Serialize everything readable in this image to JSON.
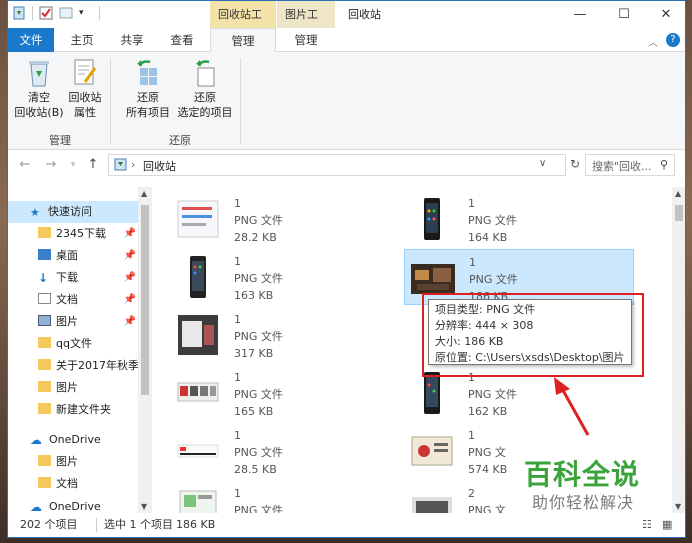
{
  "title": {
    "context_recycle": "回收站工具",
    "context_picture": "图片工具",
    "window_title": "回收站"
  },
  "tabs": [
    "文件",
    "主页",
    "共享",
    "查看",
    "管理",
    "管理"
  ],
  "ribbon": {
    "empty_line1": "清空",
    "empty_line2": "回收站(B)",
    "props_line1": "回收站",
    "props_line2": "属性",
    "restore_all_line1": "还原",
    "restore_all_line2": "所有项目",
    "restore_sel_line1": "还原",
    "restore_sel_line2": "选定的项目",
    "group_manage": "管理",
    "group_restore": "还原"
  },
  "address": {
    "path": "回收站",
    "search_placeholder": "搜索\"回收...",
    "nav_back": "←",
    "nav_forward": "→",
    "nav_up": "↑"
  },
  "nav_pane": {
    "quick_access": "快速访问",
    "items": [
      {
        "label": "2345下载",
        "pinned": true
      },
      {
        "label": "桌面",
        "pinned": true
      },
      {
        "label": "下载",
        "pinned": true
      },
      {
        "label": "文档",
        "pinned": true
      },
      {
        "label": "图片",
        "pinned": true
      },
      {
        "label": "qq文件",
        "pinned": false
      },
      {
        "label": "关于2017年秋季",
        "pinned": false
      },
      {
        "label": "图片",
        "pinned": false
      },
      {
        "label": "新建文件夹",
        "pinned": false
      }
    ],
    "onedrive": "OneDrive",
    "onedrive_items": [
      "图片",
      "文档"
    ],
    "onedrive2": "OneDrive"
  },
  "files": {
    "left": [
      {
        "name": "1",
        "type": "PNG 文件",
        "size": "28.2 KB"
      },
      {
        "name": "1",
        "type": "PNG 文件",
        "size": "163 KB"
      },
      {
        "name": "1",
        "type": "PNG 文件",
        "size": "317 KB"
      },
      {
        "name": "1",
        "type": "PNG 文件",
        "size": "165 KB"
      },
      {
        "name": "1",
        "type": "PNG 文件",
        "size": "28.5 KB"
      },
      {
        "name": "1",
        "type": "PNG 文件",
        "size": ""
      }
    ],
    "right": [
      {
        "name": "1",
        "type": "PNG 文件",
        "size": "164 KB"
      },
      {
        "name": "1",
        "type": "PNG 文件",
        "size": "186 KB"
      },
      {
        "name": "",
        "type": "",
        "size": ""
      },
      {
        "name": "1",
        "type": "PNG 文件",
        "size": "162 KB"
      },
      {
        "name": "1",
        "type": "PNG 文",
        "size": "574 KB"
      },
      {
        "name": "2",
        "type": "PNG 文",
        "size": ""
      }
    ]
  },
  "tooltip": {
    "line1": "项目类型: PNG 文件",
    "line2": "分辨率: 444 × 308",
    "line3": "大小: 186 KB",
    "line4": "原位置: C:\\Users\\xsds\\Desktop\\图片"
  },
  "status": {
    "count": "202 个项目",
    "selected": "选中 1 个项目",
    "selected_size": "186 KB"
  },
  "watermark": {
    "line1": "百科全说",
    "line2": "助你轻松解决"
  },
  "colors": {
    "file_tab": "#1979ca",
    "selection": "#cce8ff",
    "highlight_red": "#e02020",
    "watermark_green": "#3aa33a"
  }
}
